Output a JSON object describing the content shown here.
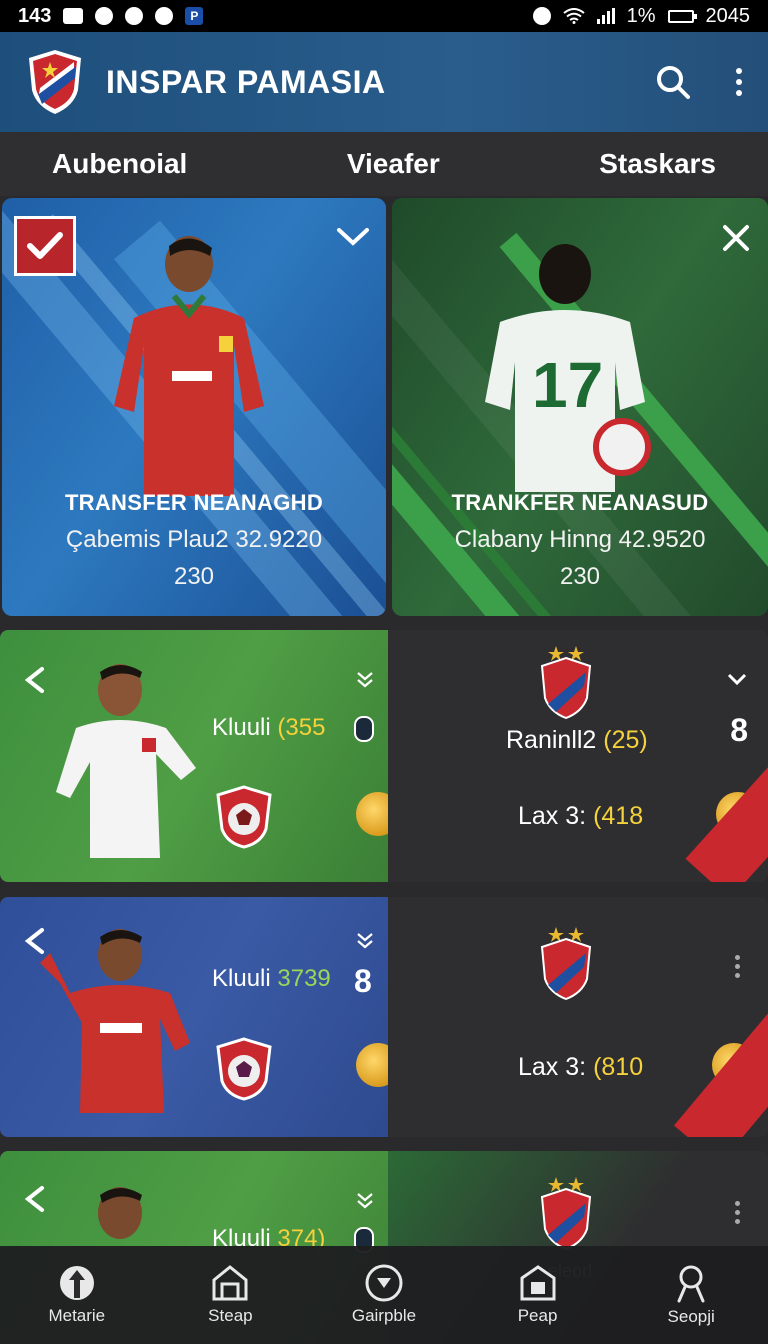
{
  "status_bar": {
    "time": "143",
    "battery": "1%",
    "clock": "2045"
  },
  "app": {
    "title": "INSPAR PAMASIA"
  },
  "tabs": [
    {
      "label": "Aubenoial"
    },
    {
      "label": "Vieafer"
    },
    {
      "label": "Staskars"
    }
  ],
  "cards": [
    {
      "title": "TRANSFER NEANAGHD",
      "line1": "Çabemis Plau2 32.9220",
      "line2": "230"
    },
    {
      "title": "TRANKFER NEANASUD",
      "line1": "Clabany Hinng 42.9520",
      "line2": "230",
      "jersey_number": "17"
    }
  ],
  "rows": [
    {
      "left_label": "Kluuli",
      "left_value": "(355",
      "right_team": "Raninll2",
      "right_value": "(25)",
      "right_count": "8",
      "lax_label": "Lax 3:",
      "lax_value": "(418"
    },
    {
      "left_label": "Kluuli",
      "left_value": "3739",
      "left_count": "8",
      "lax_label": "Lax 3:",
      "lax_value": "(810"
    },
    {
      "left_label": "Kluuli",
      "left_value": "374)",
      "right_caption": "eleorl"
    }
  ],
  "bottom_nav": [
    {
      "label": "Metarie"
    },
    {
      "label": "Steap"
    },
    {
      "label": "Gairpble"
    },
    {
      "label": "Peap"
    },
    {
      "label": "Seopji"
    }
  ],
  "colors": {
    "appbar": "#245580",
    "accent_yellow": "#f5d13b",
    "accent_red": "#c8282e",
    "green_card": "#2f6a3a",
    "blue_card": "#2d79bf"
  }
}
